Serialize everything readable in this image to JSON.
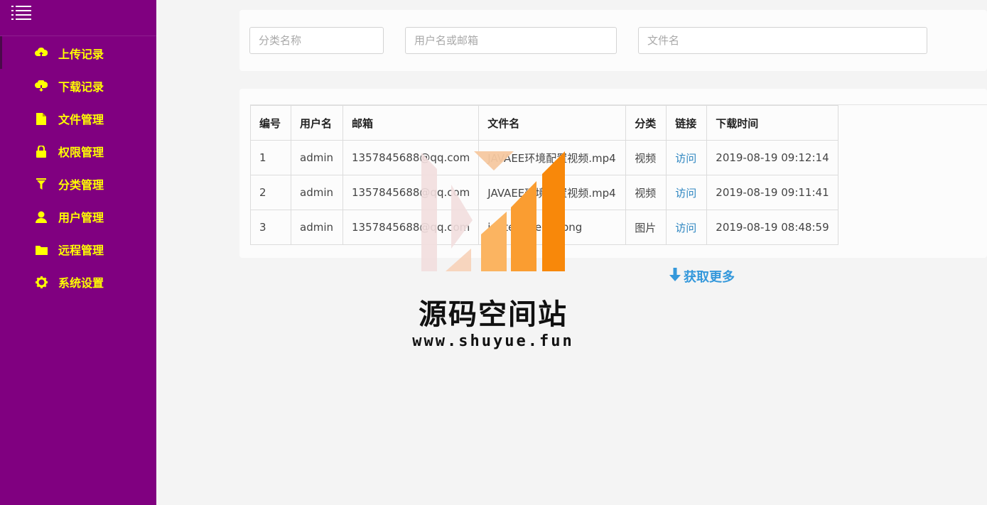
{
  "sidebar": {
    "items": [
      {
        "label": "上传记录",
        "icon": "cloud-upload-icon"
      },
      {
        "label": "下载记录",
        "icon": "cloud-download-icon"
      },
      {
        "label": "文件管理",
        "icon": "file-icon"
      },
      {
        "label": "权限管理",
        "icon": "lock-icon"
      },
      {
        "label": "分类管理",
        "icon": "filter-icon"
      },
      {
        "label": "用户管理",
        "icon": "user-icon"
      },
      {
        "label": "远程管理",
        "icon": "folder-icon"
      },
      {
        "label": "系统设置",
        "icon": "gear-icon"
      }
    ]
  },
  "filters": {
    "category_placeholder": "分类名称",
    "user_placeholder": "用户名或邮箱",
    "file_placeholder": "文件名"
  },
  "table": {
    "headers": [
      "编号",
      "用户名",
      "邮箱",
      "文件名",
      "分类",
      "链接",
      "下载时间"
    ],
    "rows": [
      {
        "id": "1",
        "user": "admin",
        "email": "1357845688@qq.com",
        "file": "JAVAEE环境配置视频.mp4",
        "category": "视频",
        "link": "访问",
        "time": "2019-08-19 09:12:14"
      },
      {
        "id": "2",
        "user": "admin",
        "email": "1357845688@qq.com",
        "file": "JAVAEE环境配置视频.mp4",
        "category": "视频",
        "link": "访问",
        "time": "2019-08-19 09:11:41"
      },
      {
        "id": "3",
        "user": "admin",
        "email": "1357845688@qq.com",
        "file": "jnotes-theme.png",
        "category": "图片",
        "link": "访问",
        "time": "2019-08-19 08:48:59"
      }
    ]
  },
  "load_more": "获取更多",
  "watermark": {
    "title": "源码空间站",
    "url": "www.shuyue.fun"
  },
  "colors": {
    "sidebar_bg": "#800080",
    "menu_text": "#ffff00",
    "link": "#2e86c1",
    "accent": "#3498db"
  }
}
